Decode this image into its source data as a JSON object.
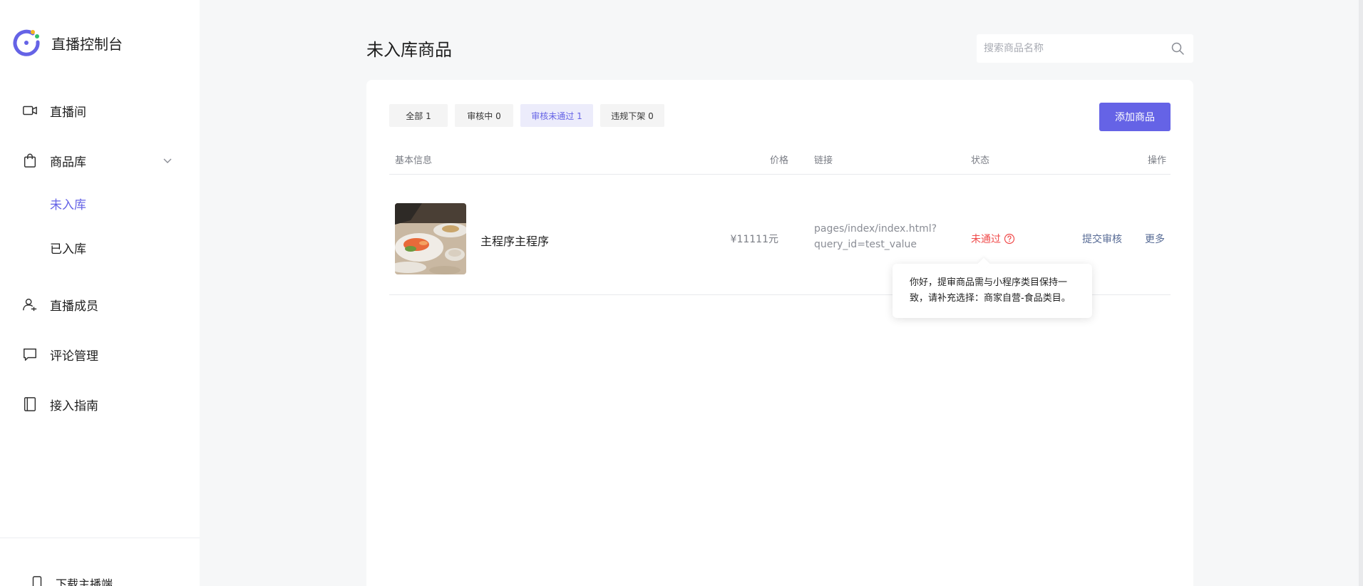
{
  "app": {
    "title": "直播控制台"
  },
  "sidebar": {
    "items": [
      {
        "label": "直播间",
        "icon": "video-camera-icon"
      },
      {
        "label": "商品库",
        "icon": "shopping-bag-icon"
      },
      {
        "label": "直播成员",
        "icon": "member-icon"
      },
      {
        "label": "评论管理",
        "icon": "comment-icon"
      },
      {
        "label": "接入指南",
        "icon": "book-icon"
      }
    ],
    "goods_sub": [
      {
        "label": "未入库",
        "active": true
      },
      {
        "label": "已入库",
        "active": false
      }
    ],
    "download": {
      "label": "下载主播端",
      "icon": "phone-icon"
    }
  },
  "main": {
    "title": "未入库商品",
    "search": {
      "placeholder": "搜索商品名称",
      "value": ""
    },
    "tabs": [
      {
        "label": "全部 1",
        "active": false
      },
      {
        "label": "审核中 0",
        "active": false
      },
      {
        "label": "审核未通过 1",
        "active": true
      },
      {
        "label": "违规下架 0",
        "active": false
      }
    ],
    "add_button": "添加商品",
    "table": {
      "headers": {
        "basic": "基本信息",
        "price": "价格",
        "link": "链接",
        "status": "状态",
        "actions": "操作"
      },
      "rows": [
        {
          "name": "主程序主程序",
          "price": "¥11111元",
          "link_line1": "pages/index/index.html?",
          "link_line2": "query_id=test_value",
          "status": "未通过",
          "submit": "提交审核",
          "more": "更多"
        }
      ]
    },
    "tooltip": "你好，提审商品需与小程序类目保持一致，请补充选择：商家自营-食品类目。"
  },
  "colors": {
    "accent": "#6563e6",
    "danger": "#f04a4a",
    "link": "#576b95",
    "background": "#f6f7f8"
  }
}
